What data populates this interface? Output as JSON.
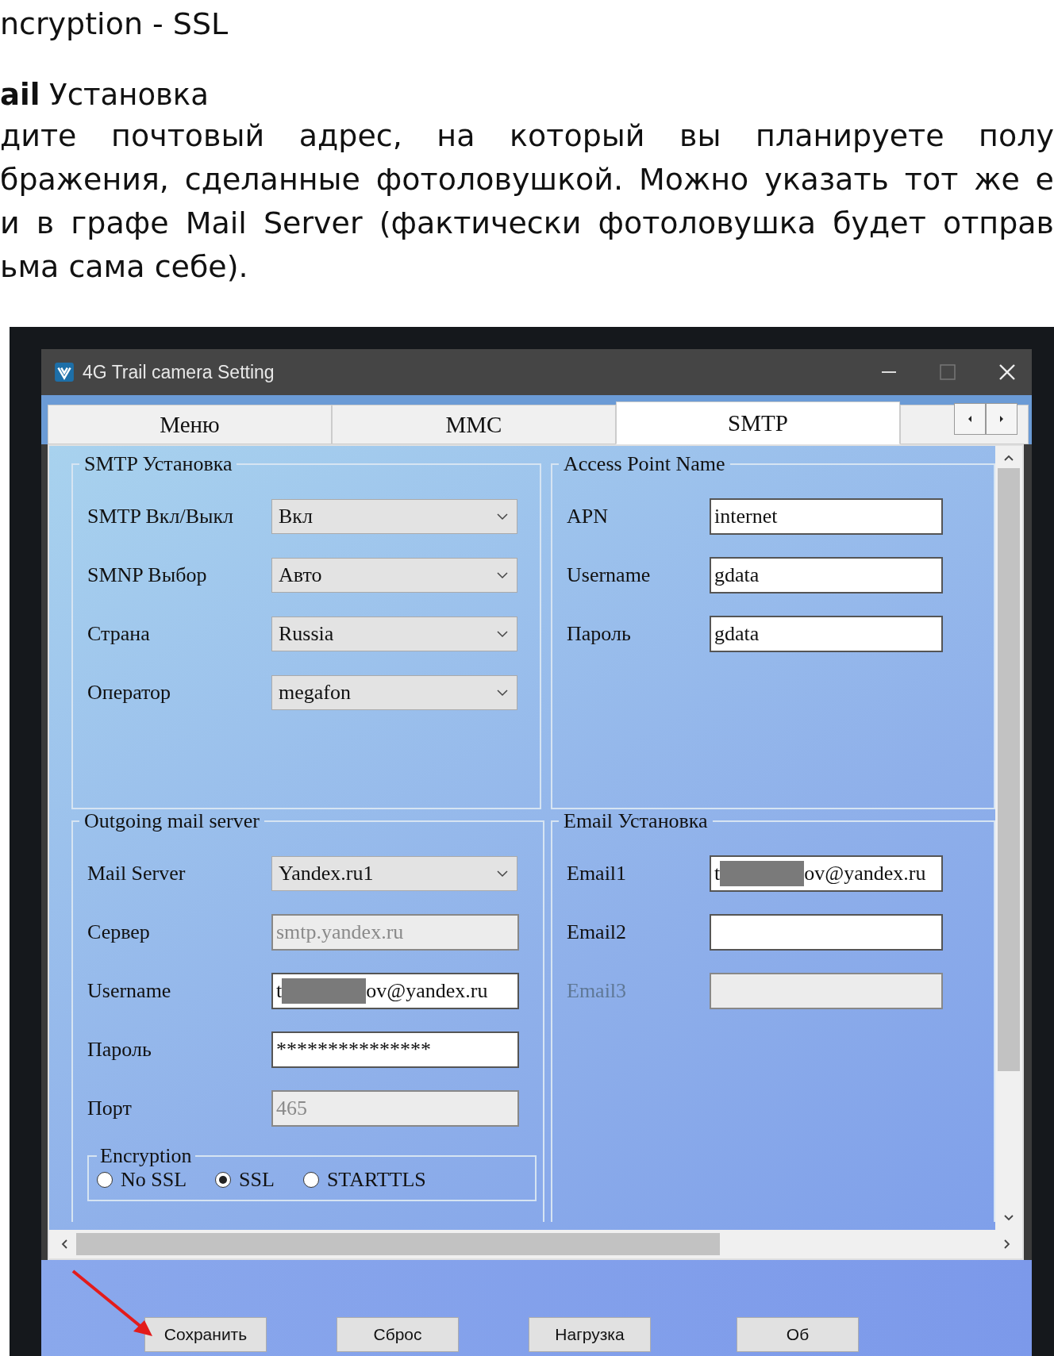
{
  "article": {
    "heading": "ncryption - SSL",
    "subheading": "**ail** Установка",
    "lines": [
      "дите почтовый адрес, на который вы планируете полу",
      "бражения, сделанные фотоловушкой. Можно указать тот же е",
      "и в графе Mail Server (фактически фотоловушка будет отправ",
      "ьма сама себе)."
    ]
  },
  "window": {
    "title": "4G Trail camera Setting"
  },
  "tabs": [
    {
      "label": "Меню",
      "selected": false
    },
    {
      "label": "MMC",
      "selected": false
    },
    {
      "label": "SMTP",
      "selected": true
    }
  ],
  "smtp_group": {
    "title": "SMTP Установка",
    "rows": [
      {
        "label": "SMTP Вкл/Выкл",
        "value": "Вкл"
      },
      {
        "label": "SMNP Выбор",
        "value": "Авто"
      },
      {
        "label": "Страна",
        "value": "Russia"
      },
      {
        "label": "Оператор",
        "value": "megafon"
      }
    ]
  },
  "apn_group": {
    "title": "Access Point Name",
    "rows": [
      {
        "label": "APN",
        "value": "internet"
      },
      {
        "label": "Username",
        "value": "gdata"
      },
      {
        "label": "Пароль",
        "value": "gdata"
      }
    ]
  },
  "mail_group": {
    "title": "Outgoing mail server",
    "rows": [
      {
        "kind": "select",
        "label": "Mail Server",
        "value": "Yandex.ru1",
        "disabled": false
      },
      {
        "kind": "text",
        "label": "Сервер",
        "value": "smtp.yandex.ru",
        "disabled": true
      },
      {
        "kind": "redacted",
        "label": "Username",
        "value": "t",
        "value_end": "ov@yandex.ru",
        "disabled": false
      },
      {
        "kind": "text",
        "label": "Пароль",
        "value": "***************",
        "disabled": false
      },
      {
        "kind": "text",
        "label": "Порт",
        "value": "465",
        "disabled": true
      }
    ],
    "encryption": {
      "title": "Encryption",
      "options": [
        {
          "label": "No SSL",
          "selected": false
        },
        {
          "label": "SSL",
          "selected": true
        },
        {
          "label": "STARTTLS",
          "selected": false
        }
      ]
    }
  },
  "email_group": {
    "title": "Email Установка",
    "rows": [
      {
        "kind": "redacted",
        "label": "Email1",
        "value": "t",
        "value_end": "ov@yandex.ru",
        "disabled": false
      },
      {
        "kind": "text",
        "label": "Email2",
        "disabled": false
      },
      {
        "kind": "text",
        "label": "Email3",
        "disabled": true
      }
    ]
  },
  "buttons": [
    "Сохранить",
    "Сброс",
    "Нагрузка",
    "Об"
  ]
}
